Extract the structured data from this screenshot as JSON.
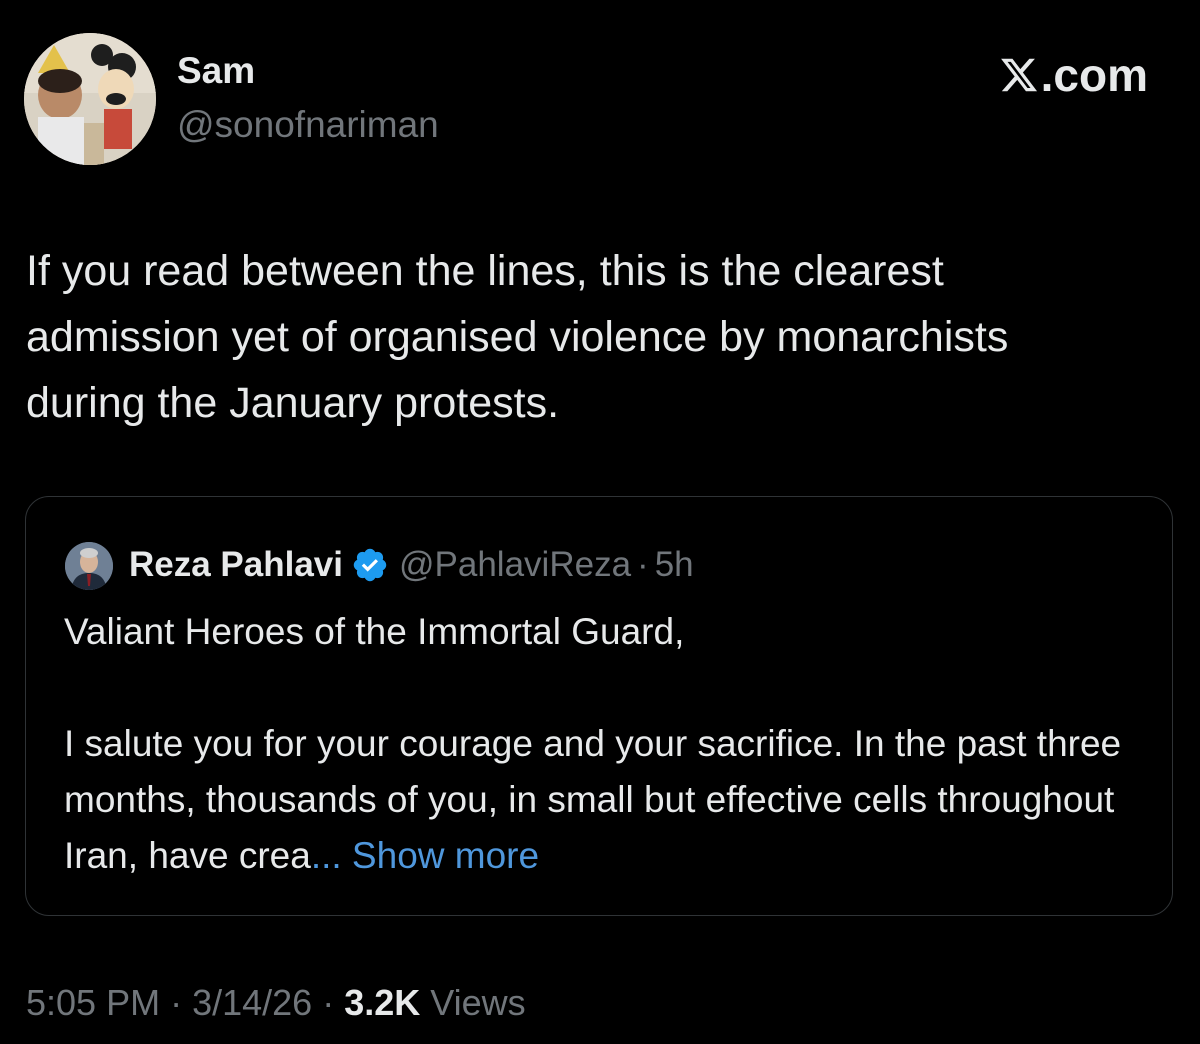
{
  "author": {
    "name": "Sam",
    "handle": "@sonofnariman"
  },
  "brand": {
    "label": ".com",
    "icon": "x-logo-icon"
  },
  "tweet": {
    "text": "If you read between the lines, this is the clearest\nadmission yet of organised violence by monarchists\nduring the January protests."
  },
  "quoted_tweet": {
    "author_name": "Reza Pahlavi",
    "verified_icon": "verified-badge-icon",
    "handle": "@PahlaviReza",
    "separator": "·",
    "time": "5h",
    "paragraph_1": "Valiant Heroes of the Immortal Guard,",
    "paragraph_2": "I salute you for your courage and your sacrifice. In the past three months, thousands of you, in small but effective cells throughout Iran, have crea",
    "ellipsis": "...",
    "show_more_label": " Show more"
  },
  "meta": {
    "time": "5:05 PM",
    "separator": " · ",
    "date": "3/14/26",
    "views_count": "3.2K",
    "views_label": " Views"
  },
  "colors": {
    "background": "#000000",
    "text_primary": "#e7e9ea",
    "text_secondary": "#71767b",
    "link": "#4f97dc",
    "verified": "#1d9bf0",
    "border": "#2f3336"
  }
}
